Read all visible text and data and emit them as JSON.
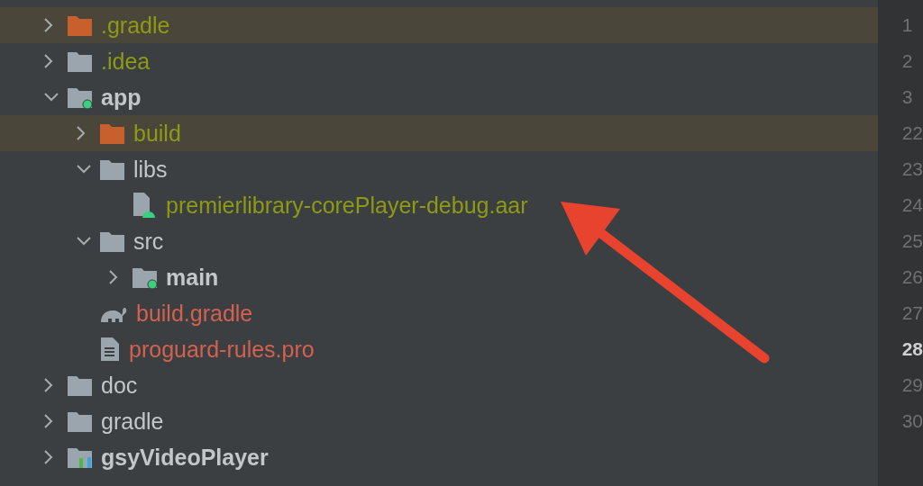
{
  "tree": [
    {
      "name": ".gradle",
      "kind": "excluded",
      "ignored": true,
      "untracked": false,
      "bold": false,
      "highlighted": true,
      "expanded": false
    },
    {
      "name": ".idea",
      "kind": "folder",
      "ignored": true,
      "untracked": false,
      "bold": false,
      "highlighted": false,
      "expanded": false
    },
    {
      "name": "app",
      "kind": "module",
      "ignored": false,
      "untracked": false,
      "bold": true,
      "highlighted": false,
      "expanded": true,
      "children": [
        {
          "name": "build",
          "kind": "excluded",
          "ignored": true,
          "untracked": false,
          "bold": false,
          "highlighted": true,
          "expanded": false
        },
        {
          "name": "libs",
          "kind": "folder",
          "ignored": false,
          "untracked": false,
          "bold": false,
          "highlighted": false,
          "expanded": true,
          "children": [
            {
              "name": "premierlibrary-corePlayer-debug.aar",
              "kind": "archive",
              "ignored": true,
              "untracked": false,
              "bold": false,
              "highlighted": false
            }
          ]
        },
        {
          "name": "src",
          "kind": "folder",
          "ignored": false,
          "untracked": false,
          "bold": false,
          "highlighted": false,
          "expanded": true,
          "children": [
            {
              "name": "main",
              "kind": "module",
              "ignored": false,
              "untracked": false,
              "bold": true,
              "highlighted": false,
              "expanded": false
            }
          ]
        },
        {
          "name": "build.gradle",
          "kind": "script",
          "ignored": false,
          "untracked": true,
          "bold": false,
          "highlighted": false
        },
        {
          "name": "proguard-rules.pro",
          "kind": "text",
          "ignored": false,
          "untracked": true,
          "bold": false,
          "highlighted": false
        }
      ]
    },
    {
      "name": "doc",
      "kind": "folder",
      "ignored": false,
      "untracked": false,
      "bold": false,
      "highlighted": false,
      "expanded": false
    },
    {
      "name": "gradle",
      "kind": "folder",
      "ignored": false,
      "untracked": false,
      "bold": false,
      "highlighted": false,
      "expanded": false
    },
    {
      "name": "gsyVideoPlayer",
      "kind": "library",
      "ignored": false,
      "untracked": false,
      "bold": true,
      "highlighted": false,
      "expanded": false
    }
  ],
  "gutter": [
    {
      "number": "1",
      "current": false
    },
    {
      "number": "2",
      "current": false
    },
    {
      "number": "3",
      "current": false
    },
    {
      "number": "22",
      "current": false
    },
    {
      "number": "23",
      "current": false
    },
    {
      "number": "24",
      "current": false
    },
    {
      "number": "25",
      "current": false
    },
    {
      "number": "26",
      "current": false
    },
    {
      "number": "27",
      "current": false
    },
    {
      "number": "28",
      "current": true
    },
    {
      "number": "29",
      "current": false
    },
    {
      "number": "30",
      "current": false
    }
  ]
}
